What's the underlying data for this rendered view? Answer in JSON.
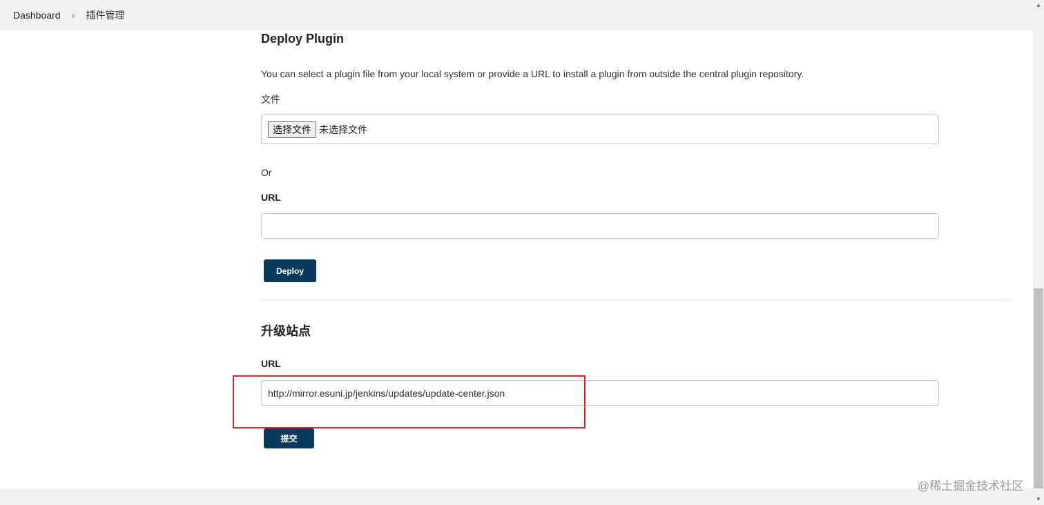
{
  "breadcrumb": {
    "items": [
      "Dashboard",
      "插件管理"
    ]
  },
  "deploy": {
    "title": "Deploy Plugin",
    "description": "You can select a plugin file from your local system or provide a URL to install a plugin from outside the central plugin repository.",
    "file_label": "文件",
    "file_button": "选择文件",
    "file_status": "未选择文件",
    "or_label": "Or",
    "url_label": "URL",
    "url_value": "",
    "deploy_button": "Deploy"
  },
  "update_site": {
    "title": "升级站点",
    "url_label": "URL",
    "url_value": "http://mirror.esuni.jp/jenkins/updates/update-center.json",
    "submit_button": "提交"
  },
  "watermark": "@稀土掘金技术社区",
  "colors": {
    "primary_button": "#0a3a5c",
    "highlight_box": "#e0202a"
  }
}
